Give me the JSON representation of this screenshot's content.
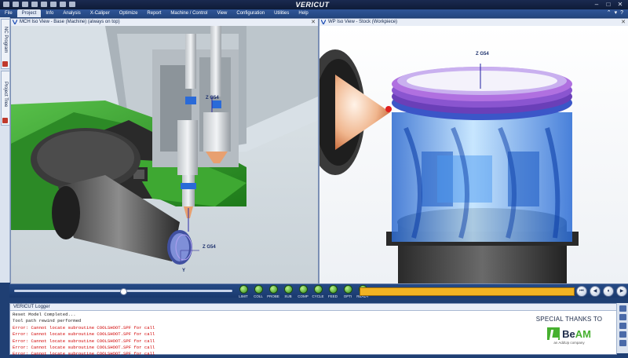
{
  "app": {
    "title": "VERICUT",
    "window_controls": {
      "minimize": "–",
      "maximize": "□",
      "close": "✕"
    },
    "quick_access_icons": [
      "save-icon",
      "undo-icon",
      "redo-icon",
      "print-icon",
      "settings-icon",
      "arrow-icon",
      "help-icon",
      "customize-icon"
    ]
  },
  "menu": {
    "items": [
      "File",
      "Project",
      "Info",
      "Analysis",
      "X-Caliper",
      "Optimize",
      "Report",
      "Machine / Control",
      "View",
      "Configuration",
      "Utilities",
      "Help"
    ],
    "active": "Project",
    "right_icons": [
      "minimize-ribbon-icon",
      "options-icon",
      "help-icon"
    ]
  },
  "left_dock": {
    "tabs": [
      {
        "label": "NC Program"
      },
      {
        "label": "Project Tree"
      }
    ]
  },
  "views": {
    "left": {
      "title": "MCH Iso View - Base (Machine) (always on top)",
      "axis_label_near_tool": "Z G54",
      "axis_y_label": "Y"
    },
    "right": {
      "title": "WP Iso View - Stock (Workpiece)",
      "axis_label": "Z G54"
    }
  },
  "playback": {
    "slider_position_fraction": 0.5,
    "indicators": [
      "LIMIT",
      "COLL",
      "PROBE",
      "SUB",
      "COMP",
      "CYCLE",
      "FEED",
      "OPTI",
      "READY"
    ],
    "indicator_color": "#3a9a1e",
    "progress_color": "#f2b322",
    "progress_fraction": 1.0,
    "buttons": [
      "rewind-button",
      "step-back-button",
      "pause-button",
      "play-button",
      "play-to-end-button"
    ]
  },
  "logger": {
    "title": "VERICUT Logger",
    "lines": [
      {
        "text": "Reset Model Completed...",
        "type": "info"
      },
      {
        "text": "Tool path rewind performed",
        "type": "info"
      },
      {
        "text": "Error: Cannot locate subroutine COOLSHOOT.SPF for call",
        "type": "error"
      },
      {
        "text": "Error: Cannot locate subroutine COOLSHOOT.SPF for call",
        "type": "error"
      },
      {
        "text": "Error: Cannot locate subroutine COOLSHOOT.SPF for call",
        "type": "error"
      },
      {
        "text": "Error: Cannot locate subroutine COOLSHOOT.SPF for call",
        "type": "error"
      },
      {
        "text": "Error: Cannot locate subroutine COOLSHOOT.SPF for call",
        "type": "error"
      }
    ]
  },
  "sponsor": {
    "thanks": "SPECIAL THANKS TO",
    "logo_text_left": "Be",
    "logo_text_right": "AM",
    "logo_subtext": "an AddUp company"
  },
  "colors": {
    "titlebar": "#14254a",
    "menubar": "#2a4f90",
    "error": "#d10000",
    "machine_green": "#2f9a2a",
    "nozzle_orange": "#e8a070",
    "stock_blue": "#3d8fe0"
  }
}
